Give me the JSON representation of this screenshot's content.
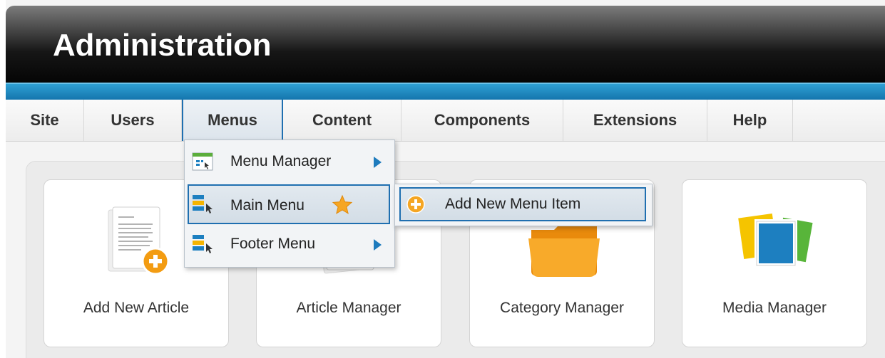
{
  "header": {
    "title": "Administration"
  },
  "menubar": {
    "tabs": [
      {
        "label": "Site"
      },
      {
        "label": "Users"
      },
      {
        "label": "Menus"
      },
      {
        "label": "Content"
      },
      {
        "label": "Components"
      },
      {
        "label": "Extensions"
      },
      {
        "label": "Help"
      }
    ],
    "active_tab": "Menus"
  },
  "dropdown": {
    "items": [
      {
        "label": "Menu Manager",
        "icon": "menu-manager-icon",
        "has_submenu": true
      },
      {
        "label": "Main Menu",
        "icon": "menu-icon",
        "badge_icon": "star-icon",
        "has_submenu": false
      },
      {
        "label": "Footer Menu",
        "icon": "menu-icon",
        "has_submenu": true
      }
    ]
  },
  "submenu": {
    "items": [
      {
        "label": "Add New Menu Item",
        "icon": "add-icon"
      }
    ]
  },
  "quickicons": [
    {
      "label": "Add New Article",
      "icon": "article-add-icon"
    },
    {
      "label": "Article Manager",
      "icon": "article-icon"
    },
    {
      "label": "Category Manager",
      "icon": "folder-icon"
    },
    {
      "label": "Media Manager",
      "icon": "media-icon"
    }
  ],
  "colors": {
    "accent_blue": "#1f6fb0",
    "stripe_blue": "#1d86c2",
    "header_dark": "#050505",
    "add_orange": "#f39c12",
    "folder_orange": "#f7a21b"
  }
}
